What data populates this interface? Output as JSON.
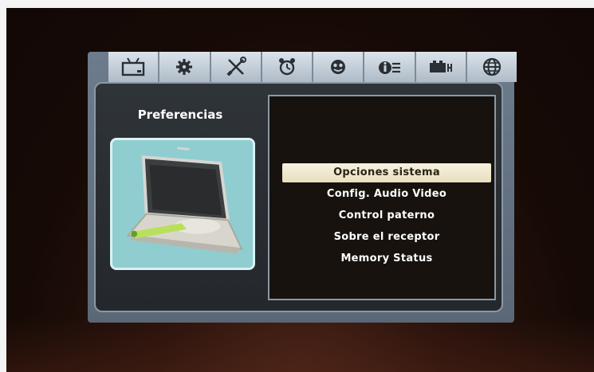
{
  "tabs": [
    {
      "icon": "tv-icon"
    },
    {
      "icon": "gear-icon"
    },
    {
      "icon": "tools-icon"
    },
    {
      "icon": "alarm-clock-icon"
    },
    {
      "icon": "face-icon"
    },
    {
      "icon": "info-icon"
    },
    {
      "icon": "usb-device-icon"
    },
    {
      "icon": "globe-icon"
    }
  ],
  "panel": {
    "title": "Preferencias",
    "image": "laptop-icon"
  },
  "menu": {
    "items": [
      {
        "label": "Opciones sistema",
        "selected": true
      },
      {
        "label": "Config. Audio Video",
        "selected": false
      },
      {
        "label": "Control paterno",
        "selected": false
      },
      {
        "label": "Sobre el receptor",
        "selected": false
      },
      {
        "label": "Memory Status",
        "selected": false
      }
    ]
  },
  "colors": {
    "selected_bg": "#f4edd6",
    "panel_bg": "#2a2f34",
    "frame": "#6d7c8c"
  }
}
